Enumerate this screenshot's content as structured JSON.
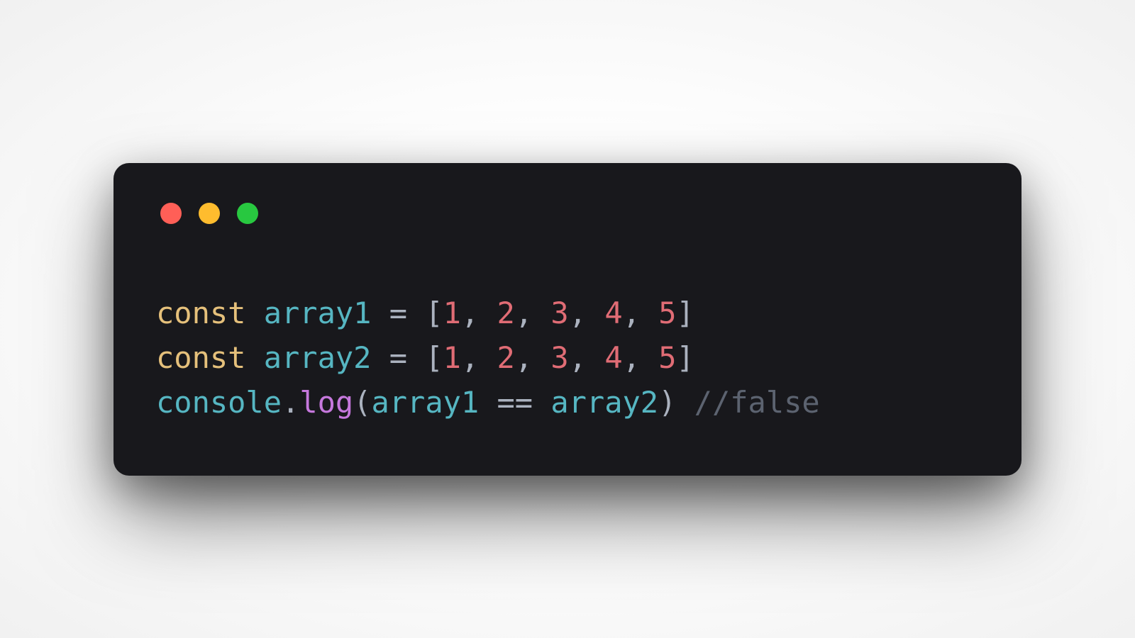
{
  "window": {
    "traffic_lights": {
      "red": "#ff5f57",
      "yellow": "#febc2e",
      "green": "#28c840"
    }
  },
  "code": {
    "lines": [
      [
        {
          "cls": "tk-kw",
          "t": "const"
        },
        {
          "cls": "",
          "t": " "
        },
        {
          "cls": "tk-var",
          "t": "array1"
        },
        {
          "cls": "",
          "t": " "
        },
        {
          "cls": "tk-op",
          "t": "="
        },
        {
          "cls": "",
          "t": " "
        },
        {
          "cls": "tk-punc",
          "t": "["
        },
        {
          "cls": "tk-num",
          "t": "1"
        },
        {
          "cls": "tk-punc",
          "t": ","
        },
        {
          "cls": "",
          "t": " "
        },
        {
          "cls": "tk-num",
          "t": "2"
        },
        {
          "cls": "tk-punc",
          "t": ","
        },
        {
          "cls": "",
          "t": " "
        },
        {
          "cls": "tk-num",
          "t": "3"
        },
        {
          "cls": "tk-punc",
          "t": ","
        },
        {
          "cls": "",
          "t": " "
        },
        {
          "cls": "tk-num",
          "t": "4"
        },
        {
          "cls": "tk-punc",
          "t": ","
        },
        {
          "cls": "",
          "t": " "
        },
        {
          "cls": "tk-num",
          "t": "5"
        },
        {
          "cls": "tk-punc",
          "t": "]"
        }
      ],
      [
        {
          "cls": "tk-kw",
          "t": "const"
        },
        {
          "cls": "",
          "t": " "
        },
        {
          "cls": "tk-var",
          "t": "array2"
        },
        {
          "cls": "",
          "t": " "
        },
        {
          "cls": "tk-op",
          "t": "="
        },
        {
          "cls": "",
          "t": " "
        },
        {
          "cls": "tk-punc",
          "t": "["
        },
        {
          "cls": "tk-num",
          "t": "1"
        },
        {
          "cls": "tk-punc",
          "t": ","
        },
        {
          "cls": "",
          "t": " "
        },
        {
          "cls": "tk-num",
          "t": "2"
        },
        {
          "cls": "tk-punc",
          "t": ","
        },
        {
          "cls": "",
          "t": " "
        },
        {
          "cls": "tk-num",
          "t": "3"
        },
        {
          "cls": "tk-punc",
          "t": ","
        },
        {
          "cls": "",
          "t": " "
        },
        {
          "cls": "tk-num",
          "t": "4"
        },
        {
          "cls": "tk-punc",
          "t": ","
        },
        {
          "cls": "",
          "t": " "
        },
        {
          "cls": "tk-num",
          "t": "5"
        },
        {
          "cls": "tk-punc",
          "t": "]"
        }
      ],
      [
        {
          "cls": "tk-var",
          "t": "console"
        },
        {
          "cls": "tk-punc",
          "t": "."
        },
        {
          "cls": "tk-method",
          "t": "log"
        },
        {
          "cls": "tk-punc",
          "t": "("
        },
        {
          "cls": "tk-var",
          "t": "array1"
        },
        {
          "cls": "",
          "t": " "
        },
        {
          "cls": "tk-op",
          "t": "=="
        },
        {
          "cls": "",
          "t": " "
        },
        {
          "cls": "tk-var",
          "t": "array2"
        },
        {
          "cls": "tk-punc",
          "t": ")"
        },
        {
          "cls": "",
          "t": " "
        },
        {
          "cls": "tk-comment",
          "t": "//false"
        }
      ]
    ]
  }
}
